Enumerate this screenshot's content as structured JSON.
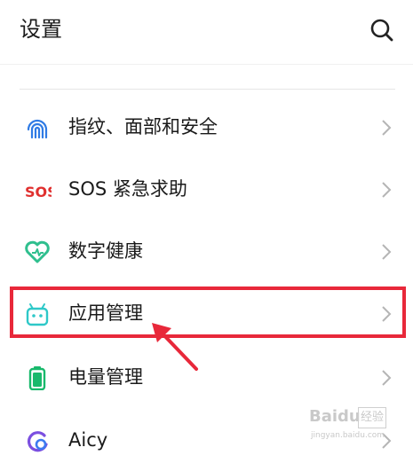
{
  "header": {
    "title": "设置",
    "search_icon": "search-icon"
  },
  "settings": {
    "items": [
      {
        "label": "指纹、面部和安全",
        "icon": "fingerprint-icon",
        "color": "#2f7be5"
      },
      {
        "label": "SOS 紧急求助",
        "icon": "sos-icon",
        "icon_text": "SOS",
        "color": "#e0302f"
      },
      {
        "label": "数字健康",
        "icon": "heart-icon",
        "color": "#2fbf8e"
      },
      {
        "label": "应用管理",
        "icon": "android-icon",
        "color": "#2ec8c8"
      },
      {
        "label": "电量管理",
        "icon": "battery-icon",
        "color": "#19b96c"
      },
      {
        "label": "Aicy",
        "icon": "aicy-icon",
        "color": "#7b4fe0"
      }
    ],
    "chevron_icon": "chevron-right-icon"
  },
  "annotation": {
    "highlight_color": "#e8283a",
    "highlighted_item": "应用管理"
  },
  "watermark": {
    "brand": "Baidu",
    "suffix": "经验",
    "url": "jingyan.baidu.com"
  }
}
